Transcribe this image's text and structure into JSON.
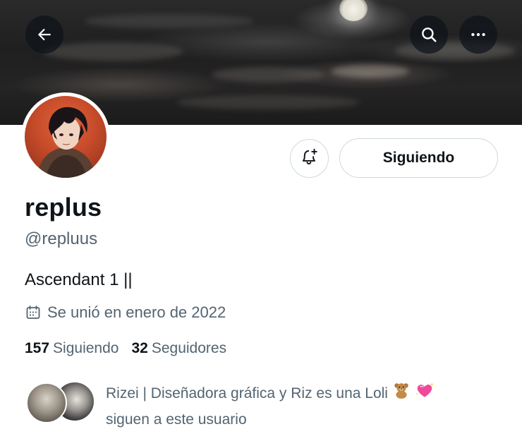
{
  "profile": {
    "display_name": "replus",
    "handle": "@repluus",
    "bio": "Ascendant 1 ||",
    "joined": "Se unió en enero de 2022",
    "following_count": "157",
    "following_label": "Siguiendo",
    "followers_count": "32",
    "followers_label": "Seguidores"
  },
  "actions": {
    "follow_state": "Siguiendo"
  },
  "icons": {
    "back": "back-arrow-icon",
    "search": "search-icon",
    "more": "more-icon",
    "notify": "bell-plus-icon",
    "calendar": "calendar-icon"
  },
  "followed_by": {
    "line1": "Rizei | Diseñadora gráfica y Riz es una Loli",
    "line2": "siguen a este usuario"
  },
  "colors": {
    "text_primary": "#0f1419",
    "text_secondary": "#536471",
    "border": "#cfd9de"
  }
}
